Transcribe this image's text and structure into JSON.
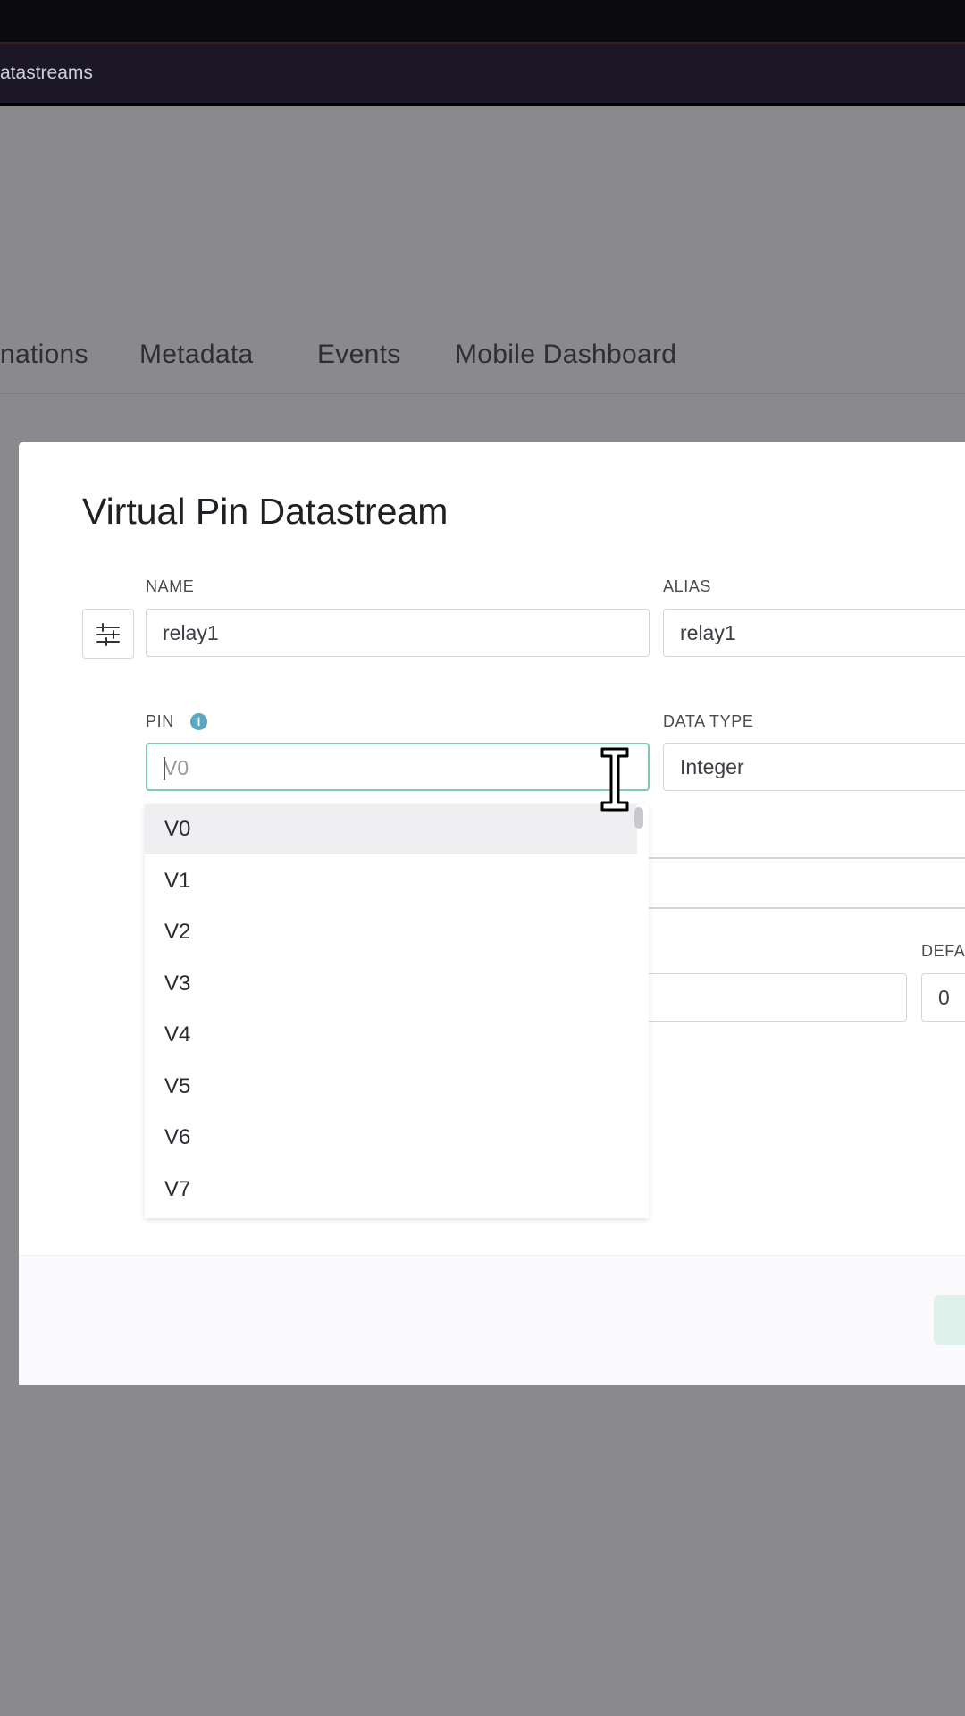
{
  "browser": {
    "tab_title": "atastreams"
  },
  "nav": {
    "tabs": [
      {
        "label": "nations"
      },
      {
        "label": "Metadata"
      },
      {
        "label": "Events"
      },
      {
        "label": "Mobile Dashboard"
      }
    ]
  },
  "modal": {
    "title": "Virtual Pin Datastream",
    "name": {
      "label": "NAME",
      "value": "relay1"
    },
    "alias": {
      "label": "ALIAS",
      "value": "relay1"
    },
    "pin": {
      "label": "PIN",
      "placeholder": "V0",
      "info_icon": "info-icon"
    },
    "data_type": {
      "label": "DATA TYPE",
      "value": "Integer"
    },
    "default": {
      "label": "DEFA",
      "value": "0"
    }
  },
  "dropdown": {
    "selected": "V0",
    "options": [
      "V0",
      "V1",
      "V2",
      "V3",
      "V4",
      "V5",
      "V6",
      "V7"
    ]
  },
  "colors": {
    "accent_border": "#7fcbb0",
    "info_dot": "#5ba7be",
    "overlay": "#8a898c"
  },
  "icons": {
    "settings_button": "sliders-icon",
    "cursor": "text-cursor-icon"
  }
}
